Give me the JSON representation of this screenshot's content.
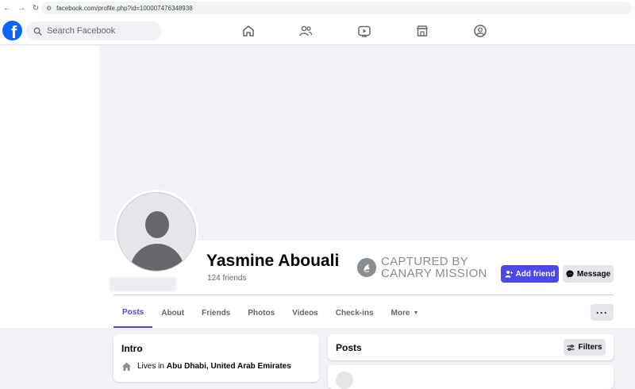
{
  "browser": {
    "url": "facebook.com/profile.php?id=100007476348938",
    "back": "←",
    "forward": "→",
    "reload": "↻"
  },
  "header": {
    "logo_letter": "f",
    "search_placeholder": "Search Facebook",
    "nav_icons": [
      "home-icon",
      "friends-icon",
      "watch-icon",
      "marketplace-icon",
      "groups-icon"
    ]
  },
  "profile": {
    "name": "Yasmine Abouali",
    "friends_count": "124 friends",
    "watermark_line1": "CAPTURED BY",
    "watermark_line2": "CANARY MISSION",
    "add_friend_label": "Add friend",
    "message_label": "Message",
    "more_dots": "···"
  },
  "tabs": [
    {
      "label": "Posts",
      "active": true
    },
    {
      "label": "About"
    },
    {
      "label": "Friends"
    },
    {
      "label": "Photos"
    },
    {
      "label": "Videos"
    },
    {
      "label": "Check-ins"
    },
    {
      "label": "More"
    }
  ],
  "intro": {
    "title": "Intro",
    "lives_prefix": "Lives in",
    "lives_place": "Abu Dhabi, United Arab Emirates"
  },
  "posts": {
    "title": "Posts",
    "filters_label": "Filters"
  },
  "colors": {
    "accent": "#4b49e9",
    "fb_blue": "#0866ff",
    "background": "#f0f2f5"
  }
}
